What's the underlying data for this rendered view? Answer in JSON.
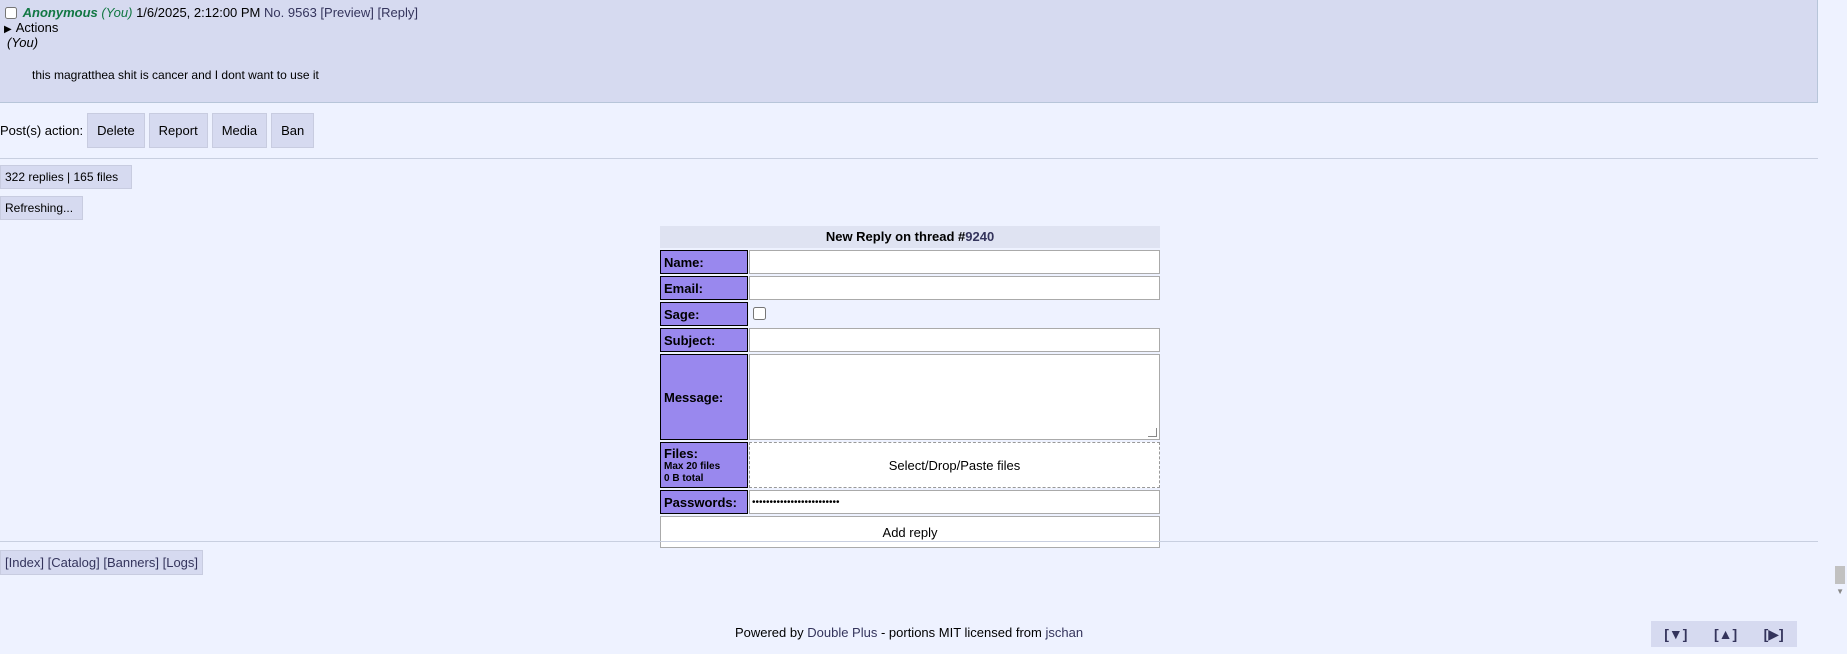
{
  "post": {
    "name": "Anonymous",
    "you_tag": "(You)",
    "date": "1/6/2025, 2:12:00 PM",
    "no_label": "No.",
    "number": "9563",
    "preview_link": "[Preview]",
    "reply_link": "[Reply]",
    "actions_label": "Actions",
    "you_line": "(You)",
    "message": "this magratthea shit is cancer and I dont want to use it"
  },
  "post_actions": {
    "label": "Post(s) action:",
    "buttons": [
      "Delete",
      "Report",
      "Media",
      "Ban"
    ]
  },
  "stats": "322 replies | 165 files",
  "refresh": "Refreshing...",
  "form": {
    "title_prefix": "New Reply on thread #",
    "thread_no": "9240",
    "name_label": "Name:",
    "email_label": "Email:",
    "sage_label": "Sage:",
    "subject_label": "Subject:",
    "message_label": "Message:",
    "files_label": "Files:",
    "files_max": "Max 20 files",
    "files_total": "0 B total",
    "files_drop": "Select/Drop/Paste files",
    "passwords_label": "Passwords:",
    "password_value": "•••••••••••••••••••••••••",
    "submit_label": "Add reply"
  },
  "nav": {
    "index": "[Index]",
    "catalog": "[Catalog]",
    "banners": "[Banners]",
    "logs": "[Logs]"
  },
  "footer": {
    "powered_by": "Powered by",
    "doubleplus": "Double Plus",
    "middle": "- portions MIT licensed from",
    "jschan": "jschan"
  },
  "scroll_arrows": {
    "down": "[▼]",
    "up": "[▲]",
    "right": "[▶]"
  }
}
